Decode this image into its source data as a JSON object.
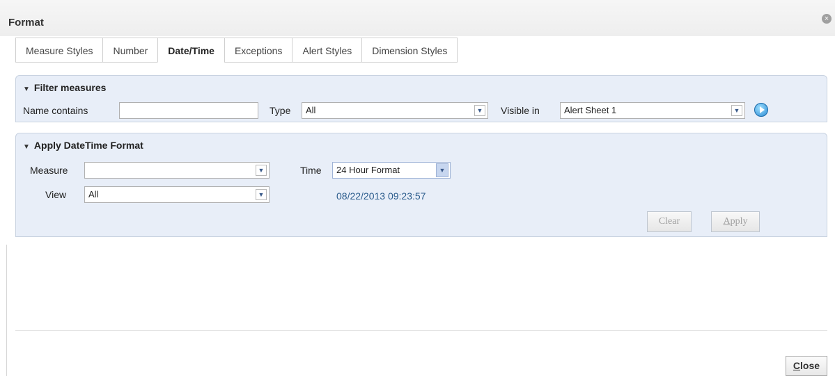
{
  "dialog": {
    "title": "Format",
    "close_icon": "close-icon"
  },
  "tabs": [
    {
      "label": "Measure Styles",
      "active": false
    },
    {
      "label": "Number",
      "active": false
    },
    {
      "label": "Date/Time",
      "active": true
    },
    {
      "label": "Exceptions",
      "active": false
    },
    {
      "label": "Alert Styles",
      "active": false
    },
    {
      "label": "Dimension Styles",
      "active": false
    }
  ],
  "filter": {
    "heading": "Filter measures",
    "name_label": "Name contains",
    "name_value": "",
    "type_label": "Type",
    "type_value": "All",
    "visible_label": "Visible in",
    "visible_value": "Alert Sheet 1",
    "go_icon": "play-icon"
  },
  "apply": {
    "heading": "Apply DateTime Format",
    "measure_label": "Measure",
    "measure_value": "",
    "view_label": "View",
    "view_value": "All",
    "time_label": "Time",
    "time_value": "24 Hour Format",
    "preview": "08/22/2013 09:23:57",
    "clear_label": "Clear",
    "apply_label_first": "A",
    "apply_label_rest": "pply"
  },
  "footer": {
    "close_first": "C",
    "close_rest": "lose"
  },
  "colors": {
    "panel_bg": "#e8eef8",
    "preview_text": "#2a5b8c"
  }
}
